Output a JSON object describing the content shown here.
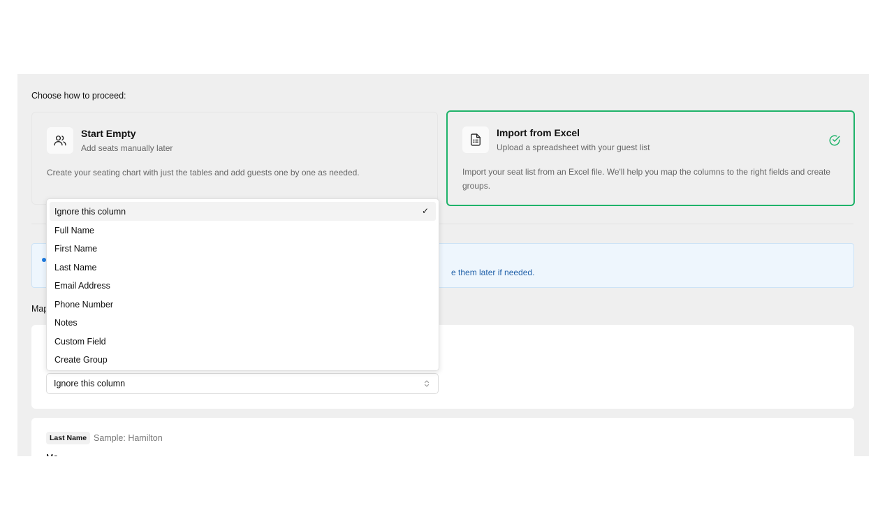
{
  "proceed_label": "Choose how to proceed:",
  "options": {
    "start_empty": {
      "title": "Start Empty",
      "subtitle": "Add seats manually later",
      "description": "Create your seating chart with just the tables and add guests one by one as needed.",
      "icon": "users-icon"
    },
    "import_excel": {
      "title": "Import from Excel",
      "subtitle": "Upload a spreadsheet with your guest list",
      "description": "Import your seat list from an Excel file. We'll help you map the columns to the right fields and create groups.",
      "icon": "spreadsheet-file-icon",
      "selected": true,
      "accent_color": "#1fb36a"
    }
  },
  "info": {
    "text_visible": "e them later if needed."
  },
  "map_label": "Map",
  "mapping": {
    "column_1": {
      "selected_value": "Ignore this column"
    },
    "column_2": {
      "badge": "Last Name",
      "sample": "Sample: Hamilton",
      "next_label": "Ma"
    }
  },
  "dropdown": {
    "selected": "Ignore this column",
    "options": [
      "Ignore this column",
      "Full Name",
      "First Name",
      "Last Name",
      "Email Address",
      "Phone Number",
      "Notes",
      "Custom Field",
      "Create Group"
    ]
  }
}
